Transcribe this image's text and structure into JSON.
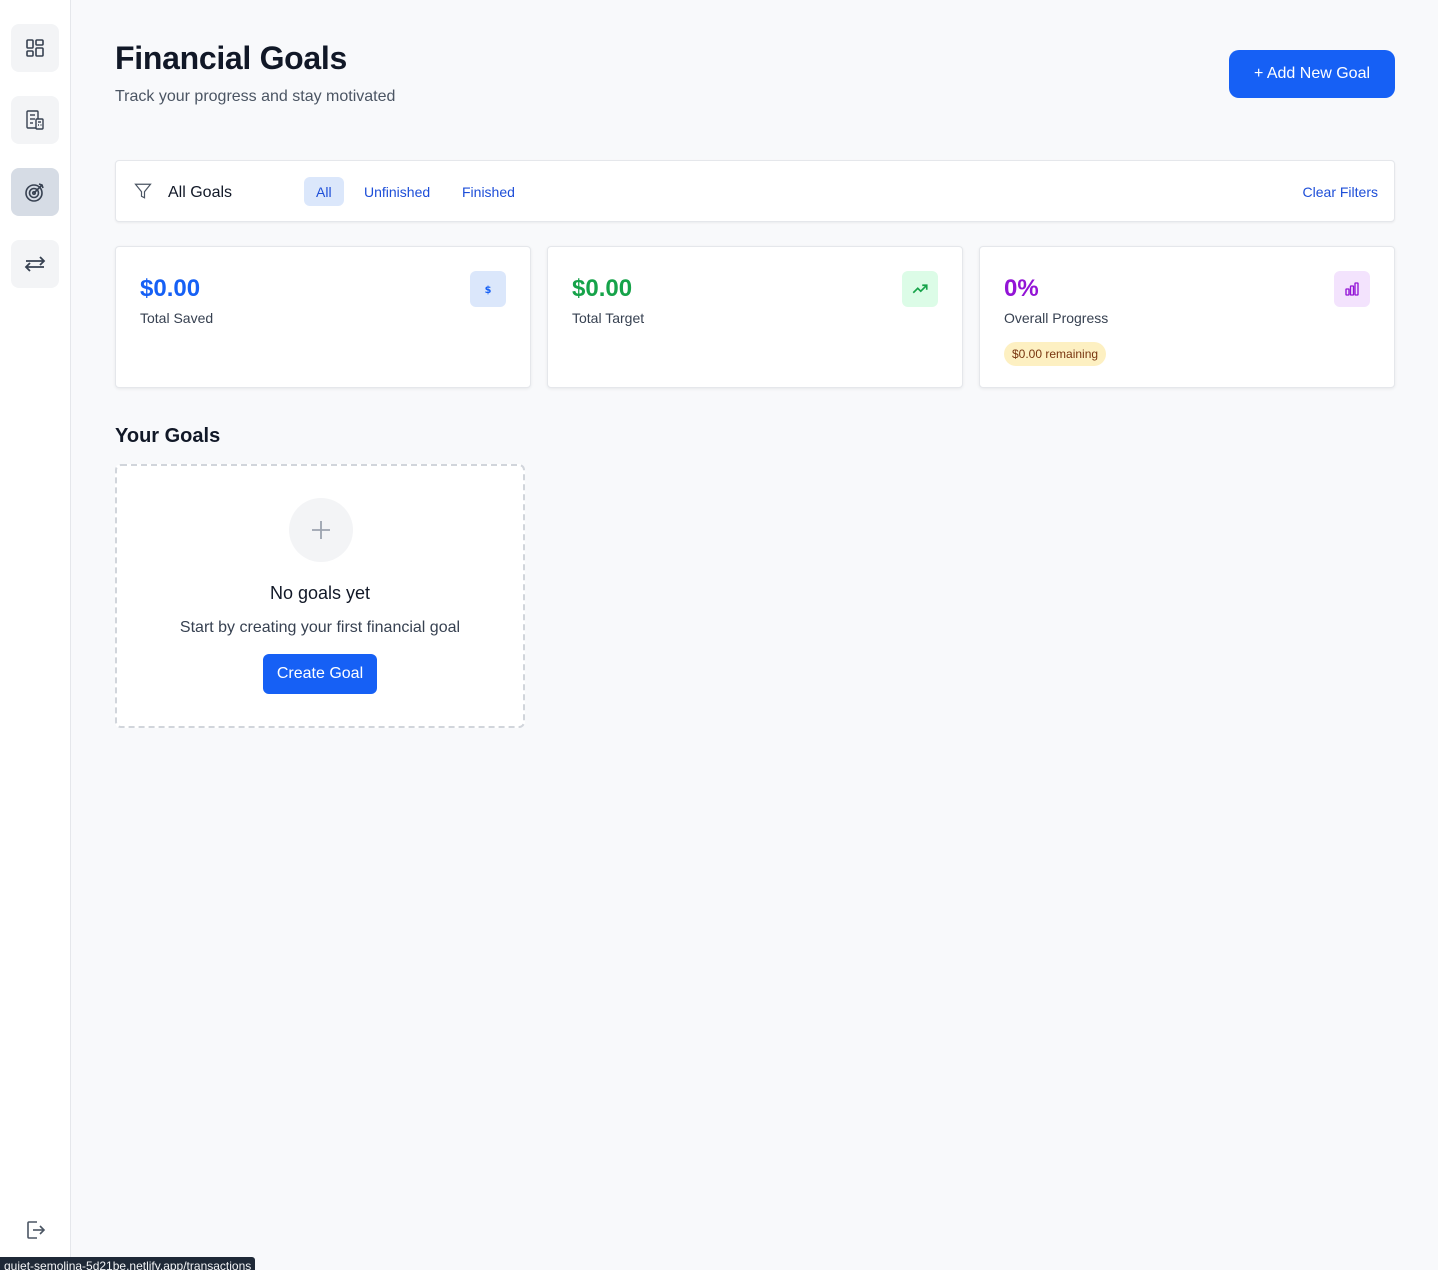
{
  "sidebar": {
    "items": [
      {
        "icon": "dashboard-icon"
      },
      {
        "icon": "budget-calculator-icon"
      },
      {
        "icon": "target-icon",
        "active": true
      },
      {
        "icon": "transfer-arrows-icon"
      }
    ],
    "logout_icon": "logout-icon"
  },
  "header": {
    "title": "Financial Goals",
    "subtitle": "Track your progress and stay motivated",
    "add_button": "+ Add New Goal"
  },
  "filters": {
    "icon": "filter-icon",
    "label": "All Goals",
    "chips": [
      "All",
      "Unfinished",
      "Finished"
    ],
    "active": "All",
    "clear": "Clear Filters"
  },
  "stats": {
    "saved": {
      "value": "$0.00",
      "label": "Total Saved",
      "color": "#1660f5",
      "icon": "dollar-icon"
    },
    "target": {
      "value": "$0.00",
      "label": "Total Target",
      "color": "#16a34a",
      "icon": "trending-up-icon"
    },
    "progress": {
      "value": "0%",
      "label": "Overall Progress",
      "color": "#9314d6",
      "icon": "bar-chart-icon",
      "remaining": "$0.00 remaining"
    }
  },
  "goals": {
    "section_title": "Your Goals",
    "empty_title": "No goals yet",
    "empty_desc": "Start by creating your first financial goal",
    "create_button": "Create Goal"
  },
  "status_url": "quiet-semolina-5d21be.netlify.app/transactions"
}
